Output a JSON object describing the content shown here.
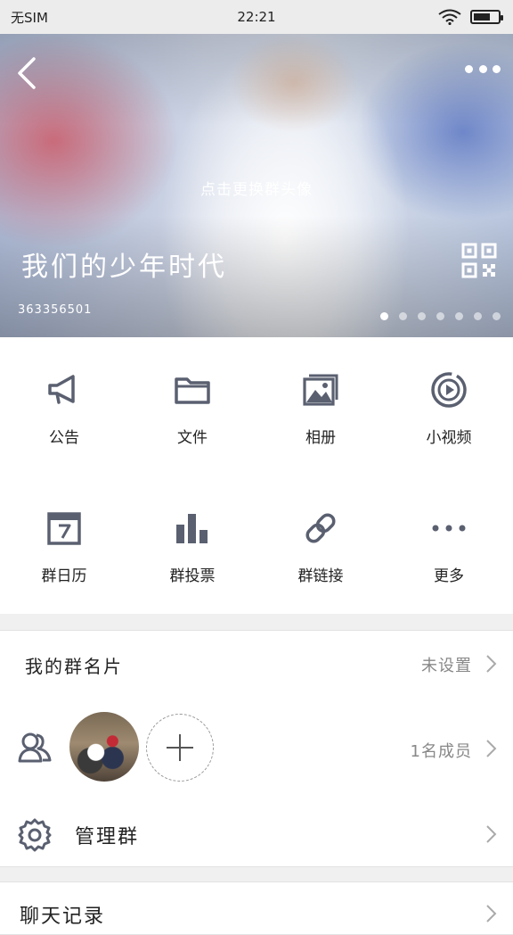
{
  "status_bar": {
    "carrier": "无SIM",
    "time": "22:21",
    "battery_percent": 70
  },
  "header": {
    "change_avatar_hint": "点击更换群头像",
    "group_name": "我们的少年时代",
    "group_id": "363356501",
    "page_count": 7,
    "active_page": 1
  },
  "grid_items": [
    {
      "label": "公告",
      "icon": "megaphone-icon"
    },
    {
      "label": "文件",
      "icon": "folder-icon"
    },
    {
      "label": "相册",
      "icon": "album-icon"
    },
    {
      "label": "小视频",
      "icon": "video-icon"
    },
    {
      "label": "群日历",
      "icon": "calendar-icon"
    },
    {
      "label": "群投票",
      "icon": "poll-icon"
    },
    {
      "label": "群链接",
      "icon": "link-icon"
    },
    {
      "label": "更多",
      "icon": "more-icon"
    }
  ],
  "my_card": {
    "title": "我的群名片",
    "value": "未设置"
  },
  "members": {
    "count_text": "1名成员"
  },
  "manage": {
    "title": "管理群"
  },
  "chat_history": {
    "title": "聊天记录"
  },
  "colors": {
    "icon_gray": "#5a6070",
    "divider": "#e2e2e2",
    "background": "#f0f0f0"
  }
}
